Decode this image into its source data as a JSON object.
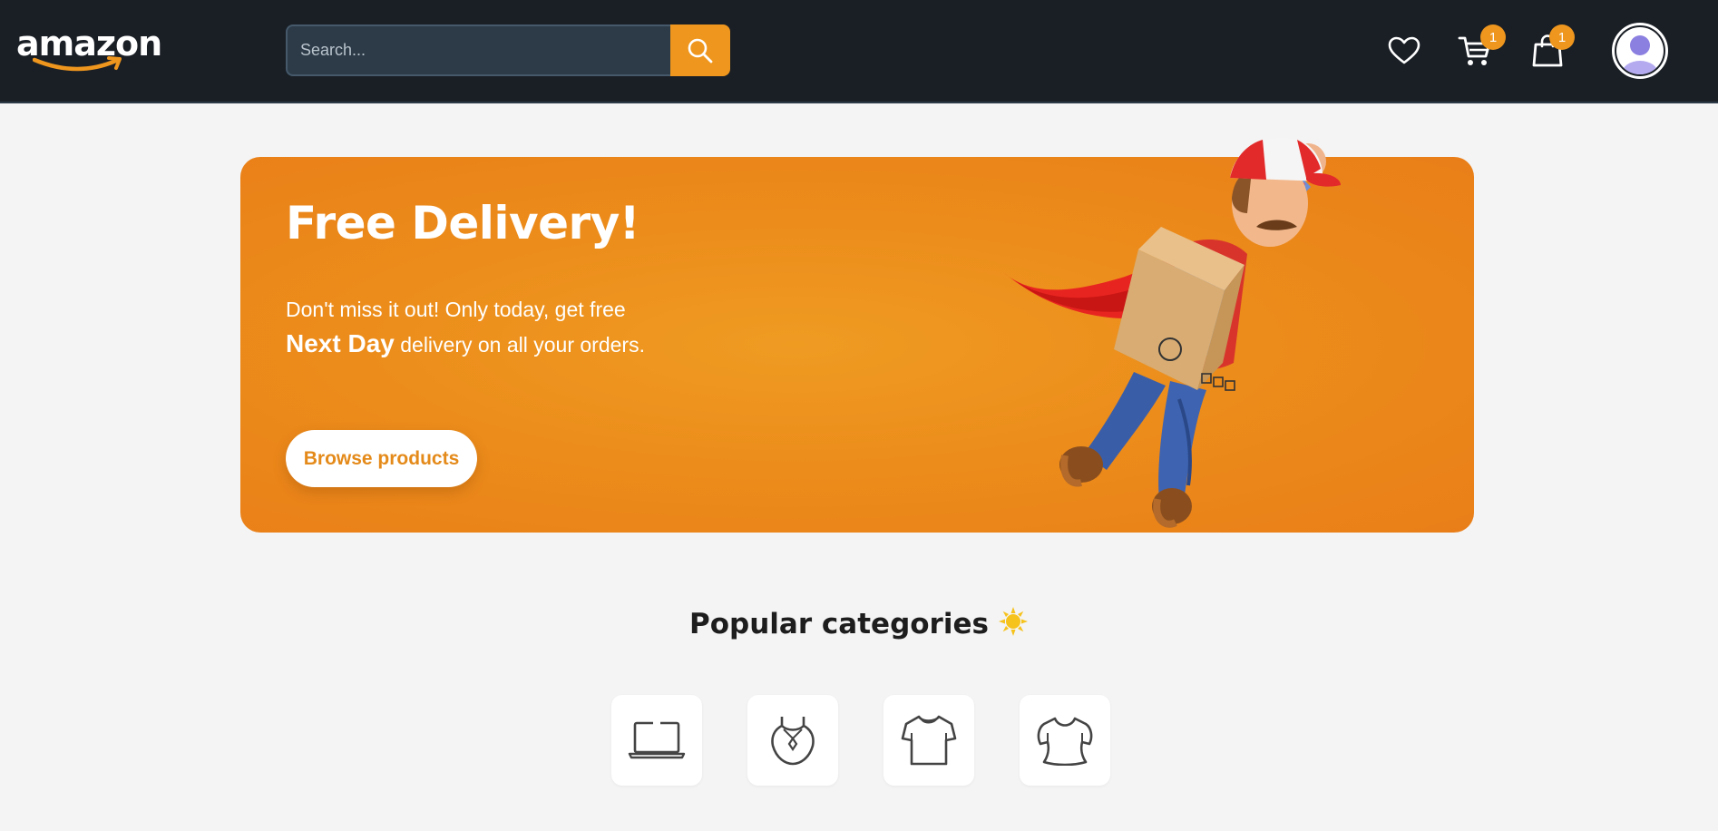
{
  "header": {
    "logo_text": "amazon",
    "search": {
      "placeholder": "Search...",
      "value": ""
    },
    "icons": {
      "wishlist": "heart-icon",
      "cart": "cart-icon",
      "cart_count": "1",
      "bag": "shopping-bag-icon",
      "bag_count": "1",
      "profile": "user-avatar-icon"
    }
  },
  "hero": {
    "title": "Free Delivery!",
    "text_before": "Don't miss it out! Only today, get free ",
    "text_strong": "Next Day",
    "text_after": " delivery on all your orders.",
    "button_label": "Browse products",
    "illustration": "flying-courier-with-box"
  },
  "categories": {
    "title": "Popular categories",
    "title_icon": "sun-icon",
    "items": [
      {
        "icon": "laptop-icon"
      },
      {
        "icon": "necklace-icon"
      },
      {
        "icon": "tshirt-icon"
      },
      {
        "icon": "blouse-icon"
      }
    ]
  },
  "colors": {
    "header_bg": "#1a1f26",
    "accent": "#ee961e",
    "page_bg": "#f4f4f4",
    "hero_orange": "#ec8d1b"
  }
}
